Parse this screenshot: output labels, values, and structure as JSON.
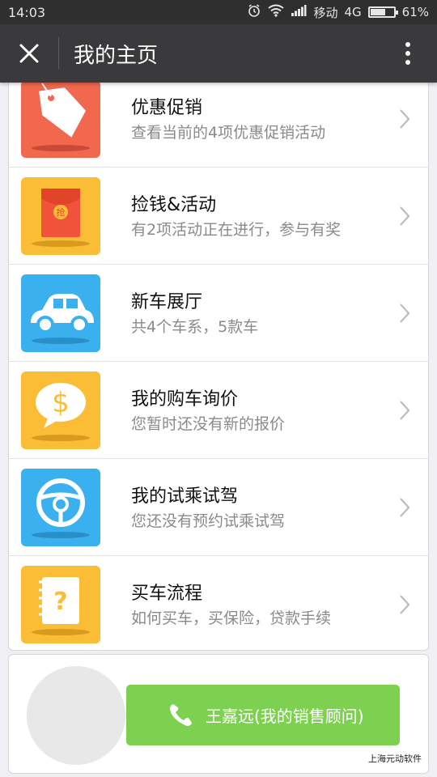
{
  "status_bar": {
    "time": "14:03",
    "carrier": "移动",
    "network": "4G",
    "battery": "61%",
    "battery_level": 0.61
  },
  "app_bar": {
    "title": "我的主页"
  },
  "list": [
    {
      "title": "优惠促销",
      "subtitle": "查看当前的4项优惠促销活动",
      "icon": "price-tag-icon",
      "color": "#f2684f"
    },
    {
      "title": "捡钱&活动",
      "subtitle": "有2项活动正在进行，参与有奖",
      "icon": "red-envelope-icon",
      "icon_text": "抢",
      "color": "#fbbd35"
    },
    {
      "title": "新车展厅",
      "subtitle": "共4个车系，5款车",
      "icon": "car-icon",
      "color": "#3ab0ef"
    },
    {
      "title": "我的购车询价",
      "subtitle": "您暂时还没有新的报价",
      "icon": "dollar-bubble-icon",
      "color": "#fbbd35"
    },
    {
      "title": "我的试乘试驾",
      "subtitle": "您还没有预约试乘试驾",
      "icon": "steering-wheel-icon",
      "color": "#3ab0ef"
    },
    {
      "title": "买车流程",
      "subtitle": "如何买车，买保险，贷款手续",
      "icon": "question-book-icon",
      "color": "#fbbd35"
    }
  ],
  "consultant": {
    "button_label": "王嘉远(我的销售顾问)",
    "button_color": "#7ed050"
  },
  "footer": {
    "credit": "上海元动软件"
  }
}
